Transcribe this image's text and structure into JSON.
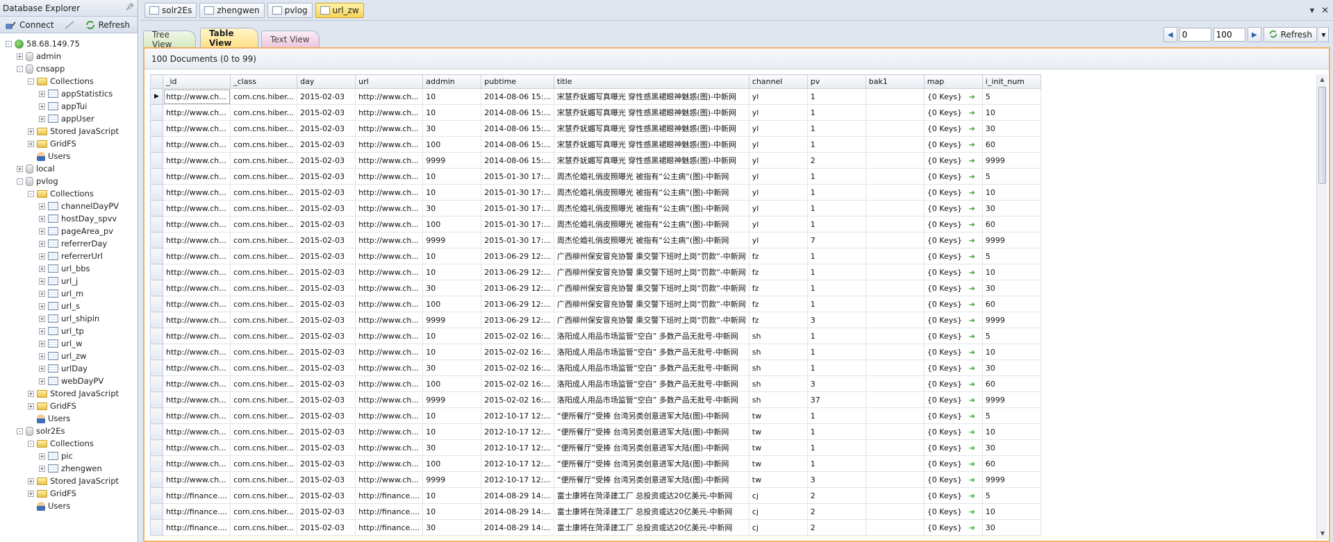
{
  "explorer": {
    "title": "Database Explorer",
    "toolbar": {
      "connect": "Connect",
      "refresh": "Refresh"
    },
    "tree": [
      {
        "depth": 0,
        "label": "58.68.149.75",
        "icon": "server",
        "exp": "-"
      },
      {
        "depth": 1,
        "label": "admin",
        "icon": "db",
        "exp": "+"
      },
      {
        "depth": 1,
        "label": "cnsapp",
        "icon": "db",
        "exp": "-"
      },
      {
        "depth": 2,
        "label": "Collections",
        "icon": "folder",
        "exp": "-"
      },
      {
        "depth": 3,
        "label": "appStatistics",
        "icon": "coll",
        "exp": "+"
      },
      {
        "depth": 3,
        "label": "appTui",
        "icon": "coll",
        "exp": "+"
      },
      {
        "depth": 3,
        "label": "appUser",
        "icon": "coll",
        "exp": "+"
      },
      {
        "depth": 2,
        "label": "Stored JavaScript",
        "icon": "folder",
        "exp": "+"
      },
      {
        "depth": 2,
        "label": "GridFS",
        "icon": "folder",
        "exp": "+"
      },
      {
        "depth": 2,
        "label": "Users",
        "icon": "user",
        "exp": ""
      },
      {
        "depth": 1,
        "label": "local",
        "icon": "db",
        "exp": "+"
      },
      {
        "depth": 1,
        "label": "pvlog",
        "icon": "db",
        "exp": "-"
      },
      {
        "depth": 2,
        "label": "Collections",
        "icon": "folder",
        "exp": "-"
      },
      {
        "depth": 3,
        "label": "channelDayPV",
        "icon": "coll",
        "exp": "+"
      },
      {
        "depth": 3,
        "label": "hostDay_spvv",
        "icon": "coll",
        "exp": "+"
      },
      {
        "depth": 3,
        "label": "pageArea_pv",
        "icon": "coll",
        "exp": "+"
      },
      {
        "depth": 3,
        "label": "referrerDay",
        "icon": "coll",
        "exp": "+"
      },
      {
        "depth": 3,
        "label": "referrerUrl",
        "icon": "coll",
        "exp": "+"
      },
      {
        "depth": 3,
        "label": "url_bbs",
        "icon": "coll",
        "exp": "+"
      },
      {
        "depth": 3,
        "label": "url_j",
        "icon": "coll",
        "exp": "+"
      },
      {
        "depth": 3,
        "label": "url_m",
        "icon": "coll",
        "exp": "+"
      },
      {
        "depth": 3,
        "label": "url_s",
        "icon": "coll",
        "exp": "+"
      },
      {
        "depth": 3,
        "label": "url_shipin",
        "icon": "coll",
        "exp": "+"
      },
      {
        "depth": 3,
        "label": "url_tp",
        "icon": "coll",
        "exp": "+"
      },
      {
        "depth": 3,
        "label": "url_w",
        "icon": "coll",
        "exp": "+"
      },
      {
        "depth": 3,
        "label": "url_zw",
        "icon": "coll",
        "exp": "+"
      },
      {
        "depth": 3,
        "label": "urlDay",
        "icon": "coll",
        "exp": "+"
      },
      {
        "depth": 3,
        "label": "webDayPV",
        "icon": "coll",
        "exp": "+"
      },
      {
        "depth": 2,
        "label": "Stored JavaScript",
        "icon": "folder",
        "exp": "+"
      },
      {
        "depth": 2,
        "label": "GridFS",
        "icon": "folder",
        "exp": "+"
      },
      {
        "depth": 2,
        "label": "Users",
        "icon": "user",
        "exp": ""
      },
      {
        "depth": 1,
        "label": "solr2Es",
        "icon": "db",
        "exp": "-"
      },
      {
        "depth": 2,
        "label": "Collections",
        "icon": "folder",
        "exp": "-"
      },
      {
        "depth": 3,
        "label": "pic",
        "icon": "coll",
        "exp": "+"
      },
      {
        "depth": 3,
        "label": "zhengwen",
        "icon": "coll",
        "exp": "+"
      },
      {
        "depth": 2,
        "label": "Stored JavaScript",
        "icon": "folder",
        "exp": "+"
      },
      {
        "depth": 2,
        "label": "GridFS",
        "icon": "folder",
        "exp": "+"
      },
      {
        "depth": 2,
        "label": "Users",
        "icon": "user",
        "exp": ""
      }
    ]
  },
  "doc_tabs": [
    {
      "label": "solr2Es",
      "active": false
    },
    {
      "label": "zhengwen",
      "active": false
    },
    {
      "label": "pvlog",
      "active": false
    },
    {
      "label": "url_zw",
      "active": true
    }
  ],
  "view_tabs": {
    "tree": "Tree View",
    "table": "Table View",
    "text": "Text View"
  },
  "pager": {
    "skip": "0",
    "limit": "100",
    "refresh": "Refresh"
  },
  "doc_count": "100 Documents (0 to 99)",
  "grid": {
    "columns": [
      "_id",
      "_class",
      "day",
      "url",
      "addmin",
      "pubtime",
      "title",
      "channel",
      "pv",
      "bak1",
      "map",
      "i_init_num"
    ],
    "rows": [
      [
        "http://www.ch...",
        "com.cns.hiber...",
        "2015-02-03",
        "http://www.ch...",
        "10",
        "2014-08-06 15:...",
        "宋慧乔妩媚写真曝光 穿性感黑裙眼神魅惑(图)-中新网",
        "yl",
        "1",
        "",
        "{0 Keys}",
        "5"
      ],
      [
        "http://www.ch...",
        "com.cns.hiber...",
        "2015-02-03",
        "http://www.ch...",
        "10",
        "2014-08-06 15:...",
        "宋慧乔妩媚写真曝光 穿性感黑裙眼神魅惑(图)-中新网",
        "yl",
        "1",
        "",
        "{0 Keys}",
        "10"
      ],
      [
        "http://www.ch...",
        "com.cns.hiber...",
        "2015-02-03",
        "http://www.ch...",
        "30",
        "2014-08-06 15:...",
        "宋慧乔妩媚写真曝光 穿性感黑裙眼神魅惑(图)-中新网",
        "yl",
        "1",
        "",
        "{0 Keys}",
        "30"
      ],
      [
        "http://www.ch...",
        "com.cns.hiber...",
        "2015-02-03",
        "http://www.ch...",
        "100",
        "2014-08-06 15:...",
        "宋慧乔妩媚写真曝光 穿性感黑裙眼神魅惑(图)-中新网",
        "yl",
        "1",
        "",
        "{0 Keys}",
        "60"
      ],
      [
        "http://www.ch...",
        "com.cns.hiber...",
        "2015-02-03",
        "http://www.ch...",
        "9999",
        "2014-08-06 15:...",
        "宋慧乔妩媚写真曝光 穿性感黑裙眼神魅惑(图)-中新网",
        "yl",
        "2",
        "",
        "{0 Keys}",
        "9999"
      ],
      [
        "http://www.ch...",
        "com.cns.hiber...",
        "2015-02-03",
        "http://www.ch...",
        "10",
        "2015-01-30 17:...",
        "周杰伦婚礼俏皮照曝光 被指有“公主病”(图)-中新网",
        "yl",
        "1",
        "",
        "{0 Keys}",
        "5"
      ],
      [
        "http://www.ch...",
        "com.cns.hiber...",
        "2015-02-03",
        "http://www.ch...",
        "10",
        "2015-01-30 17:...",
        "周杰伦婚礼俏皮照曝光 被指有“公主病”(图)-中新网",
        "yl",
        "1",
        "",
        "{0 Keys}",
        "10"
      ],
      [
        "http://www.ch...",
        "com.cns.hiber...",
        "2015-02-03",
        "http://www.ch...",
        "30",
        "2015-01-30 17:...",
        "周杰伦婚礼俏皮照曝光 被指有“公主病”(图)-中新网",
        "yl",
        "1",
        "",
        "{0 Keys}",
        "30"
      ],
      [
        "http://www.ch...",
        "com.cns.hiber...",
        "2015-02-03",
        "http://www.ch...",
        "100",
        "2015-01-30 17:...",
        "周杰伦婚礼俏皮照曝光 被指有“公主病”(图)-中新网",
        "yl",
        "1",
        "",
        "{0 Keys}",
        "60"
      ],
      [
        "http://www.ch...",
        "com.cns.hiber...",
        "2015-02-03",
        "http://www.ch...",
        "9999",
        "2015-01-30 17:...",
        "周杰伦婚礼俏皮照曝光 被指有“公主病”(图)-中新网",
        "yl",
        "7",
        "",
        "{0 Keys}",
        "9999"
      ],
      [
        "http://www.ch...",
        "com.cns.hiber...",
        "2015-02-03",
        "http://www.ch...",
        "10",
        "2013-06-29 12:...",
        "广西柳州保安冒充协警 乘交警下班时上岗“罚款”-中新网",
        "fz",
        "1",
        "",
        "{0 Keys}",
        "5"
      ],
      [
        "http://www.ch...",
        "com.cns.hiber...",
        "2015-02-03",
        "http://www.ch...",
        "10",
        "2013-06-29 12:...",
        "广西柳州保安冒充协警 乘交警下班时上岗“罚款”-中新网",
        "fz",
        "1",
        "",
        "{0 Keys}",
        "10"
      ],
      [
        "http://www.ch...",
        "com.cns.hiber...",
        "2015-02-03",
        "http://www.ch...",
        "30",
        "2013-06-29 12:...",
        "广西柳州保安冒充协警 乘交警下班时上岗“罚款”-中新网",
        "fz",
        "1",
        "",
        "{0 Keys}",
        "30"
      ],
      [
        "http://www.ch...",
        "com.cns.hiber...",
        "2015-02-03",
        "http://www.ch...",
        "100",
        "2013-06-29 12:...",
        "广西柳州保安冒充协警 乘交警下班时上岗“罚款”-中新网",
        "fz",
        "1",
        "",
        "{0 Keys}",
        "60"
      ],
      [
        "http://www.ch...",
        "com.cns.hiber...",
        "2015-02-03",
        "http://www.ch...",
        "9999",
        "2013-06-29 12:...",
        "广西柳州保安冒充协警 乘交警下班时上岗“罚款”-中新网",
        "fz",
        "3",
        "",
        "{0 Keys}",
        "9999"
      ],
      [
        "http://www.ch...",
        "com.cns.hiber...",
        "2015-02-03",
        "http://www.ch...",
        "10",
        "2015-02-02 16:...",
        "洛阳成人用品市场监管“空白” 多数产品无批号-中新网",
        "sh",
        "1",
        "",
        "{0 Keys}",
        "5"
      ],
      [
        "http://www.ch...",
        "com.cns.hiber...",
        "2015-02-03",
        "http://www.ch...",
        "10",
        "2015-02-02 16:...",
        "洛阳成人用品市场监管“空白” 多数产品无批号-中新网",
        "sh",
        "1",
        "",
        "{0 Keys}",
        "10"
      ],
      [
        "http://www.ch...",
        "com.cns.hiber...",
        "2015-02-03",
        "http://www.ch...",
        "30",
        "2015-02-02 16:...",
        "洛阳成人用品市场监管“空白” 多数产品无批号-中新网",
        "sh",
        "1",
        "",
        "{0 Keys}",
        "30"
      ],
      [
        "http://www.ch...",
        "com.cns.hiber...",
        "2015-02-03",
        "http://www.ch...",
        "100",
        "2015-02-02 16:...",
        "洛阳成人用品市场监管“空白” 多数产品无批号-中新网",
        "sh",
        "3",
        "",
        "{0 Keys}",
        "60"
      ],
      [
        "http://www.ch...",
        "com.cns.hiber...",
        "2015-02-03",
        "http://www.ch...",
        "9999",
        "2015-02-02 16:...",
        "洛阳成人用品市场监管“空白” 多数产品无批号-中新网",
        "sh",
        "37",
        "",
        "{0 Keys}",
        "9999"
      ],
      [
        "http://www.ch...",
        "com.cns.hiber...",
        "2015-02-03",
        "http://www.ch...",
        "10",
        "2012-10-17 12:...",
        "“便所餐厅”受捧 台湾另类创意进军大陆(图)-中新网",
        "tw",
        "1",
        "",
        "{0 Keys}",
        "5"
      ],
      [
        "http://www.ch...",
        "com.cns.hiber...",
        "2015-02-03",
        "http://www.ch...",
        "10",
        "2012-10-17 12:...",
        "“便所餐厅”受捧 台湾另类创意进军大陆(图)-中新网",
        "tw",
        "1",
        "",
        "{0 Keys}",
        "10"
      ],
      [
        "http://www.ch...",
        "com.cns.hiber...",
        "2015-02-03",
        "http://www.ch...",
        "30",
        "2012-10-17 12:...",
        "“便所餐厅”受捧 台湾另类创意进军大陆(图)-中新网",
        "tw",
        "1",
        "",
        "{0 Keys}",
        "30"
      ],
      [
        "http://www.ch...",
        "com.cns.hiber...",
        "2015-02-03",
        "http://www.ch...",
        "100",
        "2012-10-17 12:...",
        "“便所餐厅”受捧 台湾另类创意进军大陆(图)-中新网",
        "tw",
        "1",
        "",
        "{0 Keys}",
        "60"
      ],
      [
        "http://www.ch...",
        "com.cns.hiber...",
        "2015-02-03",
        "http://www.ch...",
        "9999",
        "2012-10-17 12:...",
        "“便所餐厅”受捧 台湾另类创意进军大陆(图)-中新网",
        "tw",
        "3",
        "",
        "{0 Keys}",
        "9999"
      ],
      [
        "http://finance....",
        "com.cns.hiber...",
        "2015-02-03",
        "http://finance....",
        "10",
        "2014-08-29 14:...",
        "富士康将在菏泽建工厂 总投资或达20亿美元-中新网",
        "cj",
        "2",
        "",
        "{0 Keys}",
        "5"
      ],
      [
        "http://finance....",
        "com.cns.hiber...",
        "2015-02-03",
        "http://finance....",
        "10",
        "2014-08-29 14:...",
        "富士康将在菏泽建工厂 总投资或达20亿美元-中新网",
        "cj",
        "2",
        "",
        "{0 Keys}",
        "10"
      ],
      [
        "http://finance....",
        "com.cns.hiber...",
        "2015-02-03",
        "http://finance....",
        "30",
        "2014-08-29 14:...",
        "富士康将在菏泽建工厂 总投资或达20亿美元-中新网",
        "cj",
        "2",
        "",
        "{0 Keys}",
        "30"
      ]
    ]
  },
  "colors": {
    "accent": "#f0b266",
    "active_tab": "#f5d45b",
    "arrow": "#3fa83a"
  }
}
